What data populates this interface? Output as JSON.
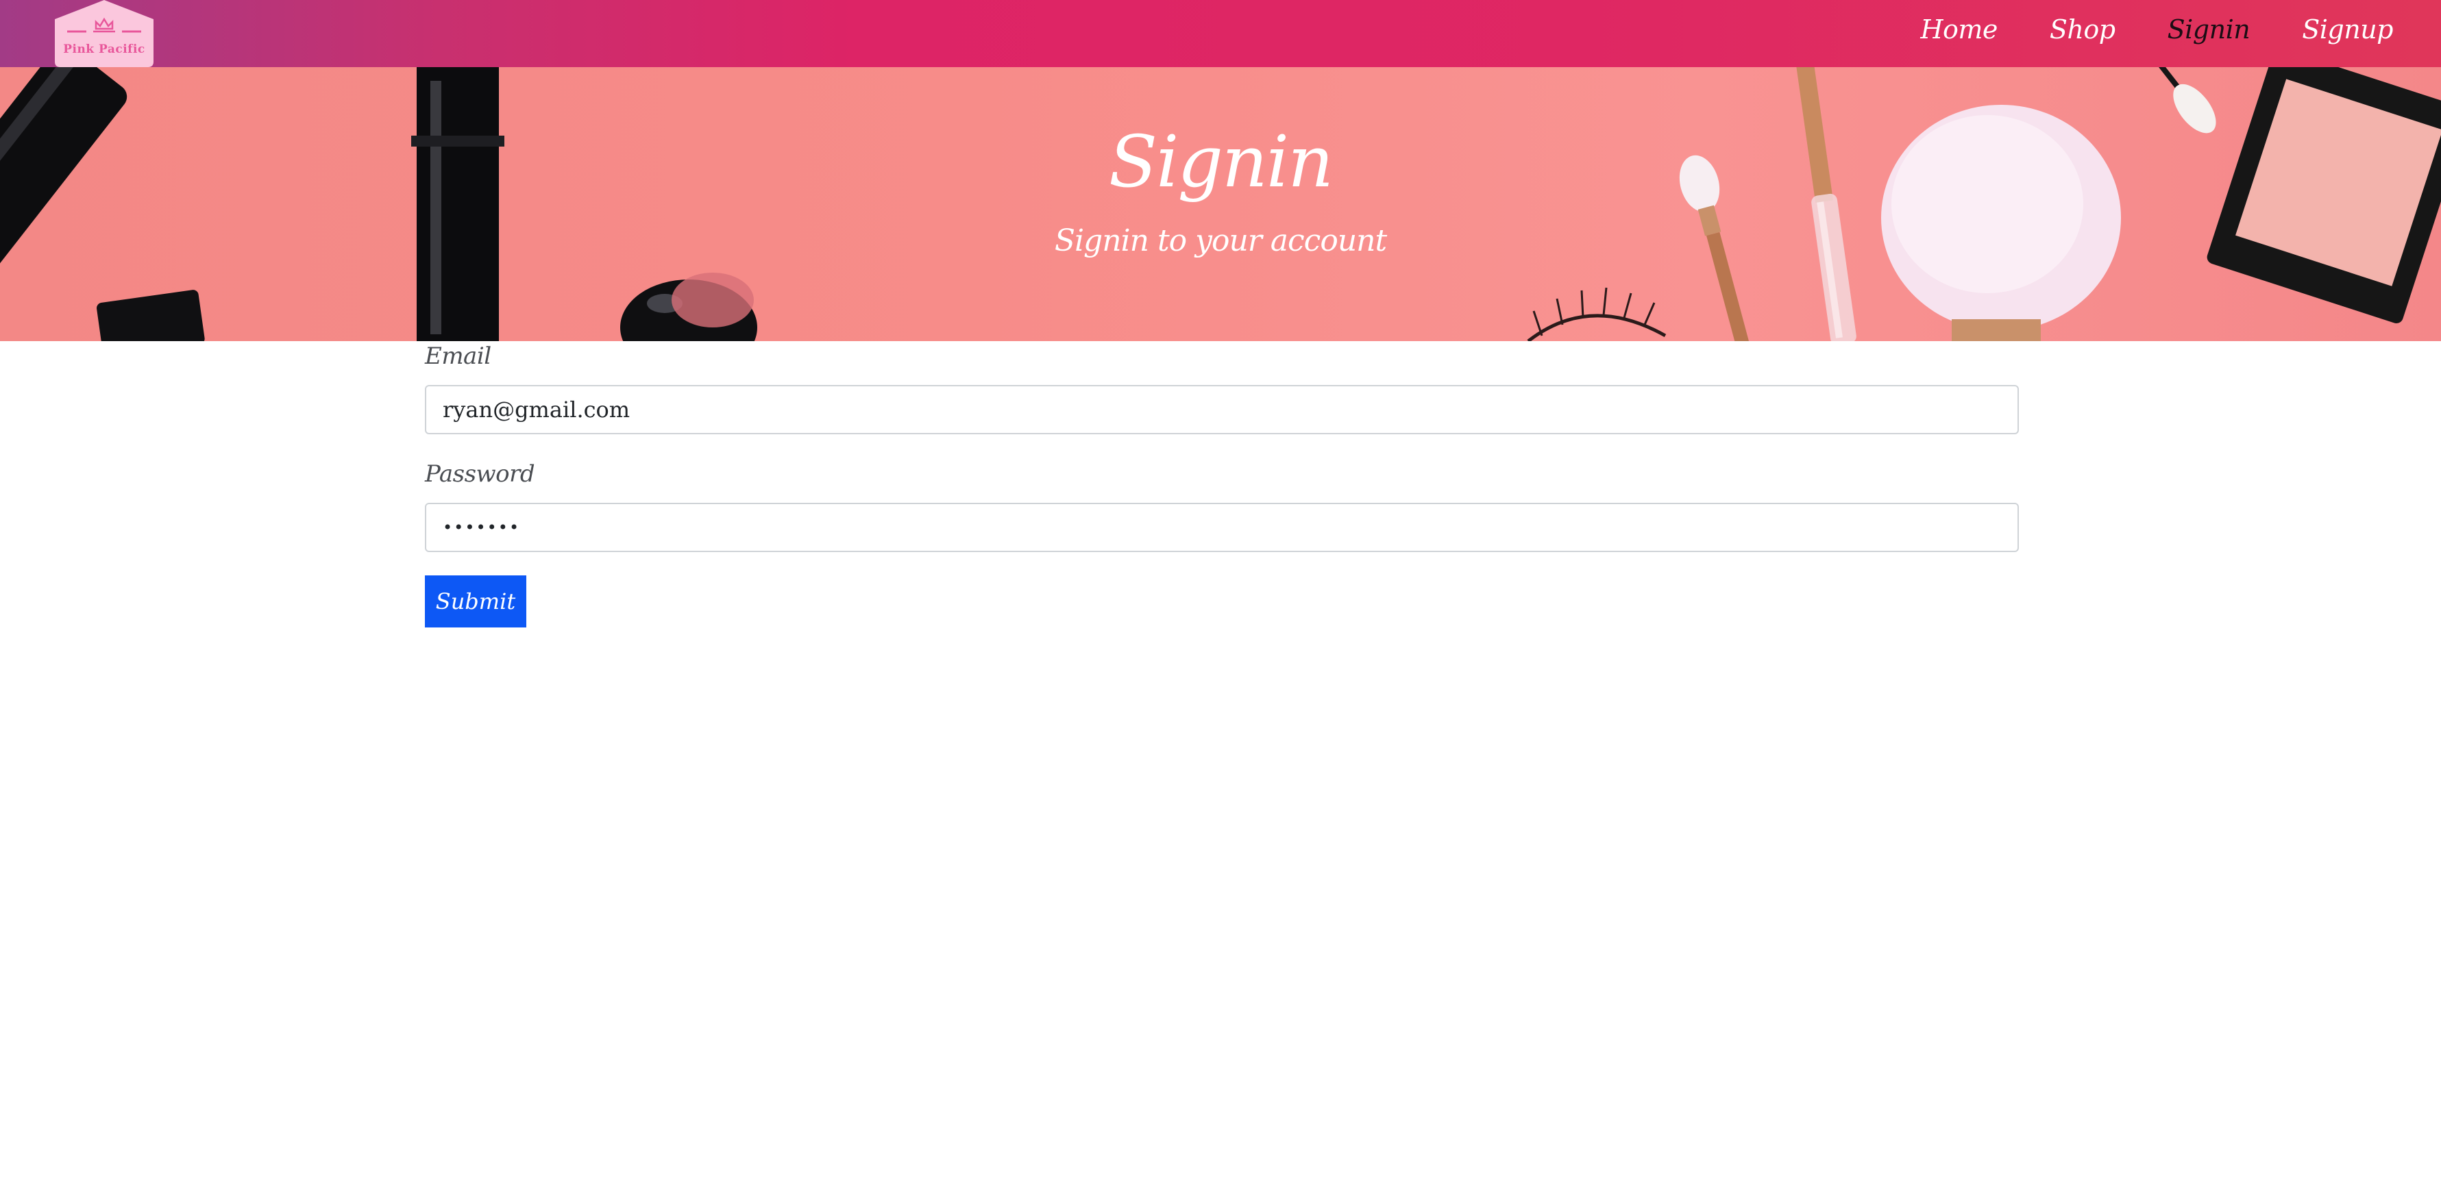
{
  "nav": {
    "logo_text": "Pink Pacific",
    "links": [
      {
        "label": "Home"
      },
      {
        "label": "Shop"
      },
      {
        "label": "Signin"
      },
      {
        "label": "Signup"
      }
    ],
    "active": "Signin"
  },
  "hero": {
    "title": "Signin",
    "subtitle": "Signin to your account"
  },
  "form": {
    "email_label": "Email",
    "email_value": "ryan@gmail.com",
    "password_label": "Password",
    "password_value": "•••••••",
    "submit_label": "Submit"
  },
  "colors": {
    "navbar_start": "#a23b86",
    "navbar_end": "#e0365a",
    "hero_bg": "#f78c89",
    "submit_button": "#0d58f5"
  }
}
